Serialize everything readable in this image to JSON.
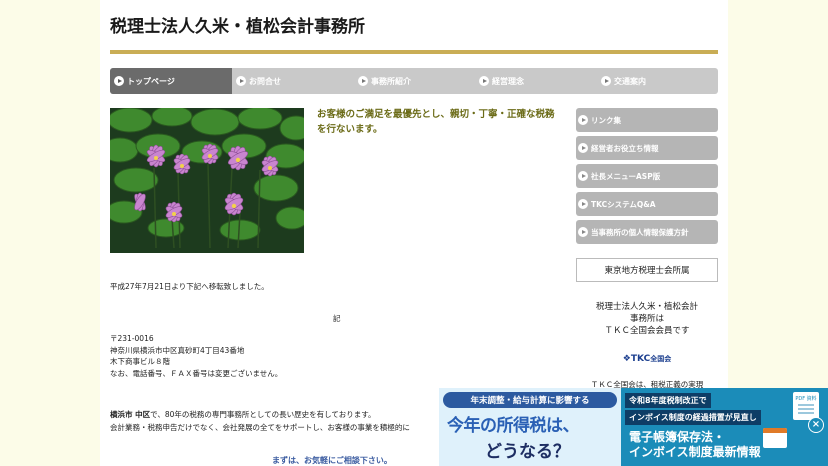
{
  "site": {
    "title": "税理士法人久米・植松会計事務所"
  },
  "global_nav": [
    {
      "label": "トップページ",
      "active": true
    },
    {
      "label": "お問合せ",
      "active": false
    },
    {
      "label": "事務所紹介",
      "active": false
    },
    {
      "label": "経営理念",
      "active": false
    },
    {
      "label": "交通案内",
      "active": false
    }
  ],
  "main": {
    "lead": "お客様のご満足を最優先とし、親切・丁寧・正確な税務を行ないます。",
    "notice": "平成27年7月21日より下記へ移転致しました。",
    "ki": "記",
    "address": {
      "postal": "〒231-0016",
      "line1": "神奈川県横浜市中区真砂町4丁目43番地",
      "line2": "木下商事ビル８階",
      "note": "なお、電話番号、ＦＡＸ番号は変更ございません。"
    },
    "intro": {
      "city_bold": "横浜市 中区",
      "line1_rest": "で、80年の税務の専門事務所としての長い歴史を有しております。",
      "line2": "会計業務・税務申告だけでなく、会社発展の全てをサポートし、お客様の事業を積極的に"
    },
    "cta": "まずは、お気軽にご相談下さい。"
  },
  "sidebar": {
    "items": [
      {
        "label": "リンク集"
      },
      {
        "label": "経営者お役立ち情報"
      },
      {
        "label": "社長メニューASP版"
      },
      {
        "label": "TKCシステムQ&A"
      },
      {
        "label": "当事務所の個人情報保護方針"
      }
    ],
    "association": "東京地方税理士会所属",
    "member_lines": [
      "税理士法人久米・植松会計",
      "事務所は",
      "ＴＫＣ全国会会員です"
    ],
    "tkc_logo": "TKC",
    "tkc_logo_sub": "全国会",
    "tkc_note": "ＴＫＣ全国会は、租税正義の実現"
  },
  "ad": {
    "left_banner": "年末調整・給与計算に影響する",
    "left_big1": "今年の所得税は、",
    "left_big2": "どうなる？",
    "right_line1": "令和8年度税制改正で",
    "right_line2": "インボイス制度の経過措置が見直し",
    "right_big1": "電子帳簿保存法・",
    "right_big2": "インボイス制度最新情報",
    "doc_label": "PDF 資料",
    "close_glyph": "×"
  },
  "colors": {
    "background": "#fcfce8",
    "title_rule": "#c9ad55",
    "nav_bg": "#c9c9c9",
    "nav_active": "#6b6b6b",
    "lead_text": "#6b6b17",
    "cta_text": "#3a5ba0",
    "ad_left": "#dff1fb",
    "ad_right": "#1b8cb9"
  },
  "icons": {
    "nav_arrow": "circle-arrow-right-icon",
    "close": "close-icon"
  }
}
